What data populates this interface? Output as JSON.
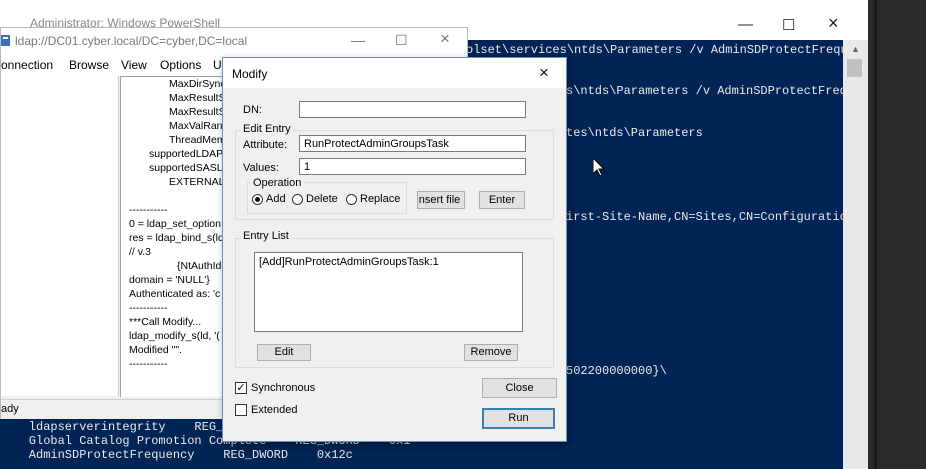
{
  "powershell": {
    "title": "Administrator: Windows PowerShell",
    "lines": [
      "olset\\services\\ntds\\Parameters /v AdminSDProtectFreque",
      "s\\ntds\\Parameters /v AdminSDProtectFreque",
      "tes\\ntds\\Parameters",
      "irst-Site-Name,CN=Sites,CN=Configuratio",
      "502200000000}\\",
      "    ldapserverintegrity    REG_D",
      "    Global Catalog Promotion Complete    REG_DWORD    0x1",
      "    AdminSDProtectFrequency    REG_DWORD    0x12c"
    ]
  },
  "ldp": {
    "title": "ldap://DC01.cyber.local/DC=cyber,DC=local",
    "menu": [
      "onnection",
      "Browse",
      "View",
      "Options",
      "Uti"
    ],
    "output_lines": [
      "MaxDirSync",
      "MaxResultS",
      "MaxResultS",
      "MaxValRan",
      "ThreadMem",
      "supportedLDAP",
      "supportedSASL",
      "EXTERNAL",
      "-----------",
      "0 = ldap_set_option",
      "res = ldap_bind_s(ld",
      "// v.3",
      "{NtAuthIde",
      "domain = 'NULL'}",
      "Authenticated as: 'c",
      "-----------",
      "***Call Modify...",
      "ldap_modify_s(ld, '(",
      "Modified \"\".",
      "-----------"
    ],
    "status": "ady"
  },
  "modify": {
    "title": "Modify",
    "dn_label": "DN:",
    "dn_value": "",
    "edit_entry_label": "Edit Entry",
    "attribute_label": "Attribute:",
    "attribute_value": "RunProtectAdminGroupsTask",
    "values_label": "Values:",
    "values_value": "1",
    "operation_label": "Operation",
    "operations": [
      "Add",
      "Delete",
      "Replace"
    ],
    "selected_operation": "Add",
    "insert_file_label": "Insert file",
    "enter_label": "Enter",
    "entry_list_label": "Entry List",
    "entries": [
      "[Add]RunProtectAdminGroupsTask:1"
    ],
    "edit_label": "Edit",
    "remove_label": "Remove",
    "synchronous_label": "Synchronous",
    "synchronous_checked": true,
    "extended_label": "Extended",
    "extended_checked": false,
    "close_label": "Close",
    "run_label": "Run"
  },
  "icons": {
    "close": "×",
    "minimize": "—",
    "maximize": "☐"
  }
}
